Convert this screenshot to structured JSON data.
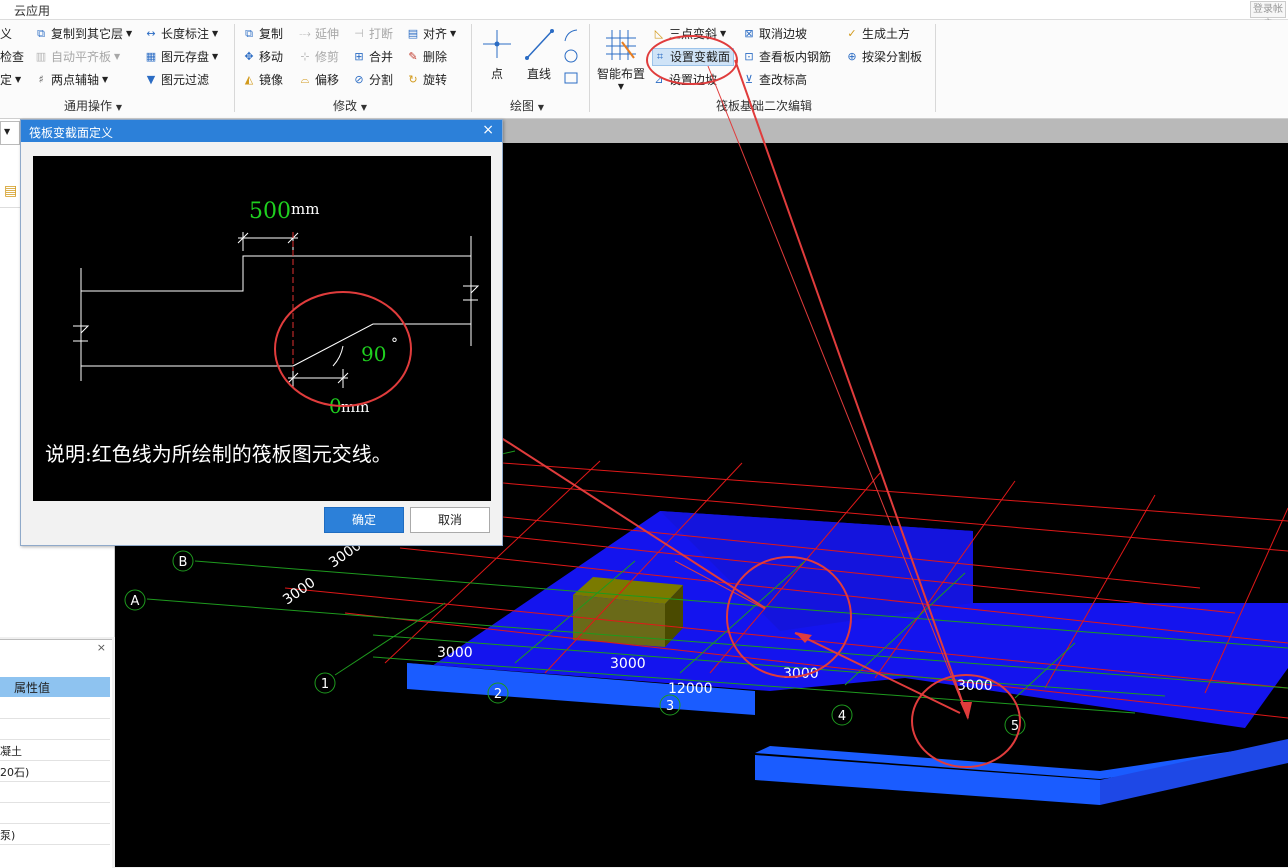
{
  "app": {
    "title": "云应用",
    "login_label": "登录帐户"
  },
  "ribbon": {
    "common": {
      "items": [
        "义",
        "检查",
        "定",
        "复制到其它层",
        "自动平齐板",
        "两点辅轴",
        "长度标注",
        "图元存盘",
        "图元过滤"
      ],
      "label": "通用操作"
    },
    "modify": {
      "items": [
        "复制",
        "延伸",
        "打断",
        "对齐",
        "移动",
        "修剪",
        "合并",
        "删除",
        "镜像",
        "偏移",
        "分割",
        "旋转"
      ],
      "label": "修改"
    },
    "draw": {
      "items": [
        "点",
        "直线"
      ],
      "label": "绘图"
    },
    "raft": {
      "smart_label": "智能布置",
      "items": [
        "三点变斜",
        "设置变截面",
        "设置边坡",
        "取消边坡",
        "查看板内钢筋",
        "查改标高",
        "生成土方",
        "按梁分割板"
      ],
      "label": "筏板基础二次编辑"
    }
  },
  "properties": {
    "header": "属性值",
    "rows": [
      "",
      "",
      "凝土",
      "20石)",
      "",
      "",
      "泵)"
    ]
  },
  "dialog": {
    "title": "筏板变截面定义",
    "top_width": "500",
    "bottom_width": "0",
    "unit": "mm",
    "angle": "90",
    "degree": "°",
    "note": "说明:红色线为所绘制的筏板图元交线。",
    "ok": "确定",
    "cancel": "取消"
  },
  "viewport": {
    "axis_letters": [
      "A",
      "B"
    ],
    "axis_numbers": [
      "1",
      "2",
      "3",
      "4",
      "5"
    ],
    "dims_front": [
      "3000",
      "3000",
      "3000",
      "3000"
    ],
    "dim_total": "12000",
    "dims_side": [
      "3000",
      "3000"
    ]
  },
  "colors": {
    "accent": "#2c80d9",
    "annotation": "#e03c3c",
    "axis": "#1e9a1e",
    "slab": "#1414ee"
  }
}
